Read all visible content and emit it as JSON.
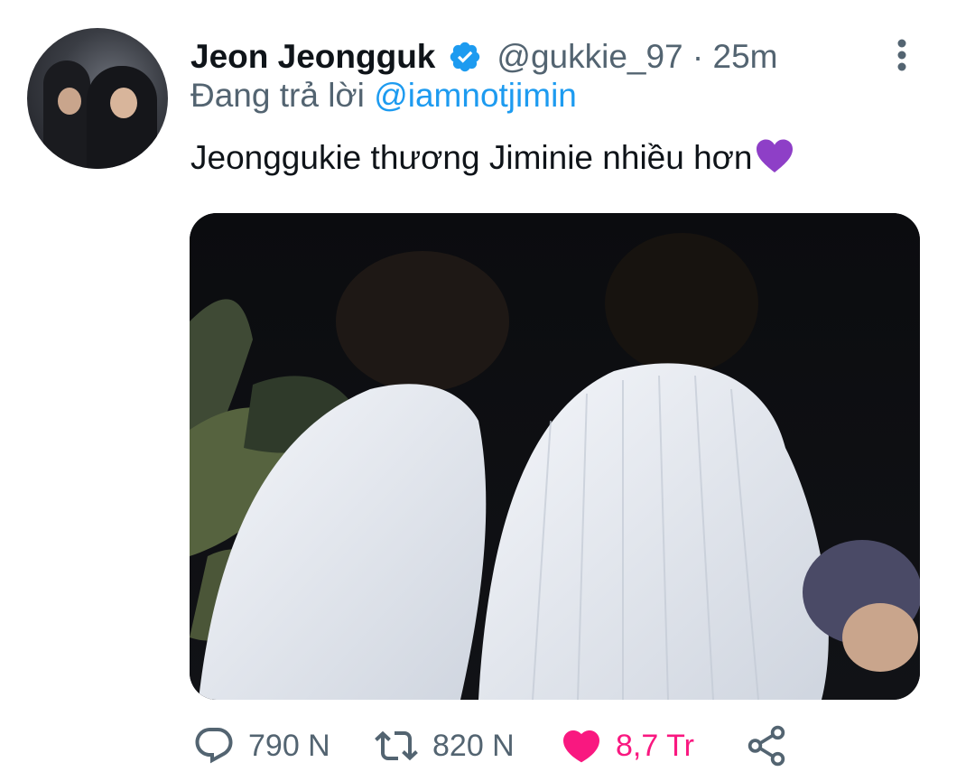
{
  "tweet": {
    "author_name": "Jeon Jeongguk",
    "handle_time": "@gukkie_97 · 25m",
    "reply_prefix": "Đang trả lời ",
    "reply_mention": "@iamnotjimin",
    "text": "Jeonggukie thương Jiminie nhiều hơn"
  },
  "actions": {
    "replies": "790 N",
    "retweets": "820 N",
    "likes": "8,7 Tr"
  },
  "colors": {
    "accent": "#1d9bf0",
    "like": "#f91880",
    "muted": "#536471",
    "emoji_heart": "#8e3fc7"
  },
  "icons": [
    "verified-badge-icon",
    "more-vertical-icon",
    "purple-heart-emoji",
    "reply-icon",
    "retweet-icon",
    "like-heart-icon",
    "share-icon"
  ]
}
